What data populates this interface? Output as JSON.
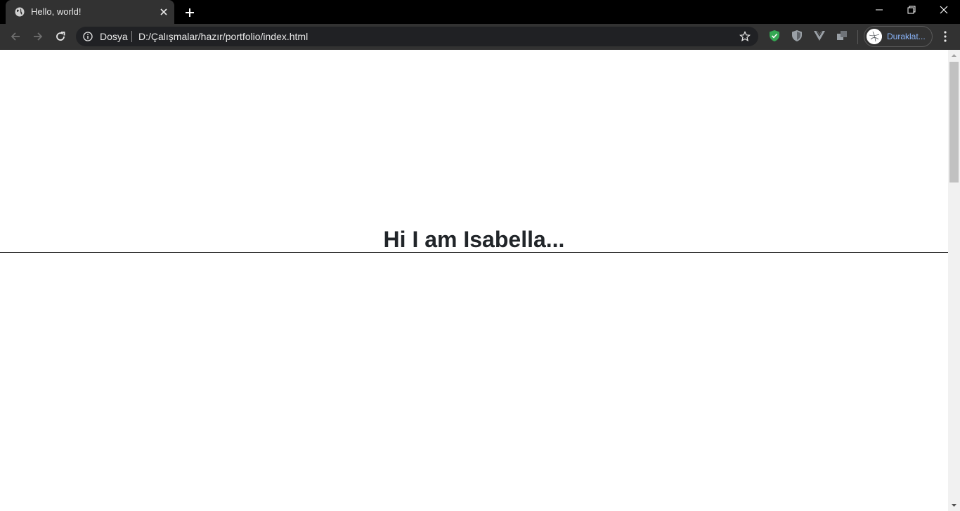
{
  "tab": {
    "title": "Hello, world!",
    "favicon": "globe-icon"
  },
  "window_controls": [
    "minimize-icon",
    "restore-icon",
    "close-icon"
  ],
  "toolbar": {
    "scheme_label": "Dosya",
    "url": "D:/Çalışmalar/hazır/portfolio/index.html",
    "profile_label": "Duraklat..."
  },
  "extensions": [
    "shield-check-icon",
    "shield-icon",
    "vue-devtools-icon",
    "extensions-icon"
  ],
  "page": {
    "heading": "Hi I am Isabella..."
  },
  "colors": {
    "tab_bg": "#323232",
    "frame_bg": "#000000",
    "omnibox_bg": "#202124",
    "accent_link": "#8ab4f8",
    "heading": "#212529"
  }
}
